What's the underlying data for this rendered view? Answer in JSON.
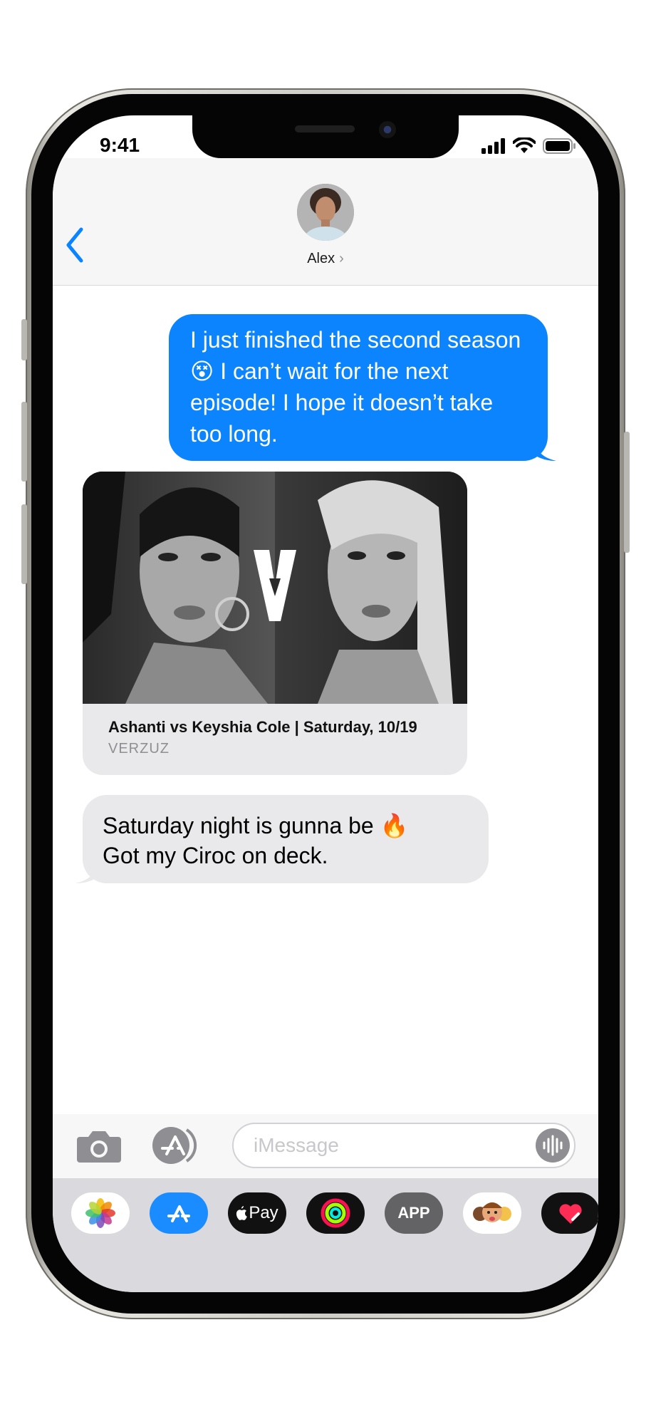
{
  "status_bar": {
    "time": "9:41"
  },
  "header": {
    "contact_name": "Alex",
    "chevron": "›"
  },
  "messages": {
    "outgoing": {
      "lines": [
        "I just finished the second season",
        "😵 I can’t wait for the next",
        "episode! I hope it doesn’t take",
        "too long."
      ]
    },
    "link_preview": {
      "title": "Ashanti vs Keyshia Cole | Saturday, 10/19",
      "domain": "VERZUZ"
    },
    "incoming": {
      "lines": [
        "Saturday night is gunna be 🔥",
        "Got my Ciroc on deck."
      ]
    }
  },
  "compose": {
    "placeholder": "iMessage"
  },
  "drawer": {
    "apps": [
      {
        "name": "photos-icon"
      },
      {
        "name": "app-store-icon"
      },
      {
        "name": "apple-pay",
        "label": "Pay"
      },
      {
        "name": "activity-icon"
      },
      {
        "name": "app",
        "label": "APP"
      },
      {
        "name": "memoji-icon"
      },
      {
        "name": "digital-touch-icon"
      }
    ]
  },
  "colors": {
    "imessage_blue": "#0b84fe",
    "incoming_gray": "#e9e9eb",
    "app_store_blue": "#1a8cff"
  }
}
